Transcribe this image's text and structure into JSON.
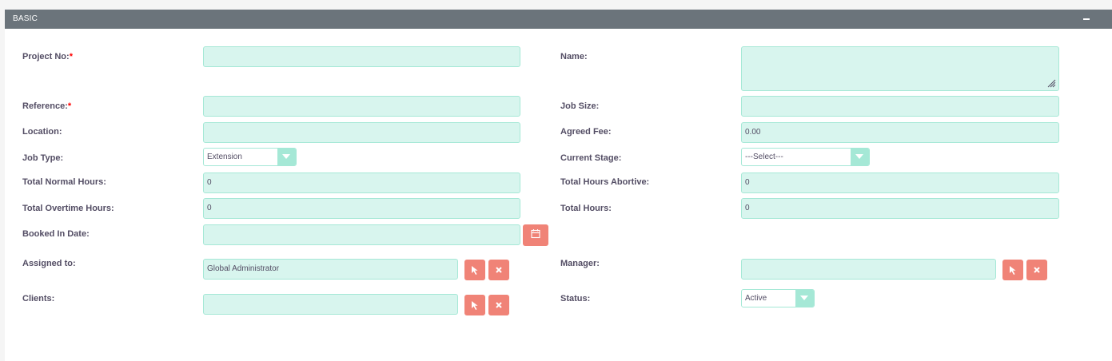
{
  "panel": {
    "title": "BASIC",
    "collapse_icon": "minus-icon"
  },
  "fields": {
    "project_no": {
      "label": "Project No:",
      "required": "*",
      "value": ""
    },
    "name": {
      "label": "Name:",
      "value": ""
    },
    "reference": {
      "label": "Reference:",
      "required": "*",
      "value": ""
    },
    "job_size": {
      "label": "Job Size:",
      "value": ""
    },
    "location": {
      "label": "Location:",
      "value": ""
    },
    "agreed_fee": {
      "label": "Agreed Fee:",
      "value": "0.00"
    },
    "job_type": {
      "label": "Job Type:",
      "selected": "Extension"
    },
    "current_stage": {
      "label": "Current Stage:",
      "selected": "---Select---"
    },
    "total_normal_hours": {
      "label": "Total Normal Hours:",
      "value": "0"
    },
    "total_hours_abortive": {
      "label": "Total Hours Abortive:",
      "value": "0"
    },
    "total_overtime_hours": {
      "label": "Total Overtime Hours:",
      "value": "0"
    },
    "total_hours": {
      "label": "Total Hours:",
      "value": "0"
    },
    "booked_in_date": {
      "label": "Booked In Date:",
      "value": "",
      "icon": "calendar-icon"
    },
    "assigned_to": {
      "label": "Assigned to:",
      "value": "Global Administrator"
    },
    "manager": {
      "label": "Manager:",
      "value": ""
    },
    "clients": {
      "label": "Clients:",
      "value": ""
    },
    "status": {
      "label": "Status:",
      "selected": "Active"
    }
  },
  "icons": {
    "select": "cursor-arrow-icon",
    "clear": "close-icon"
  },
  "colors": {
    "header_bg": "#6b747b",
    "field_bg": "#d8f5ee",
    "field_border": "#a5e8d6",
    "button_bg": "#f08377",
    "label_text": "#534d64",
    "required": "#ff0000"
  }
}
